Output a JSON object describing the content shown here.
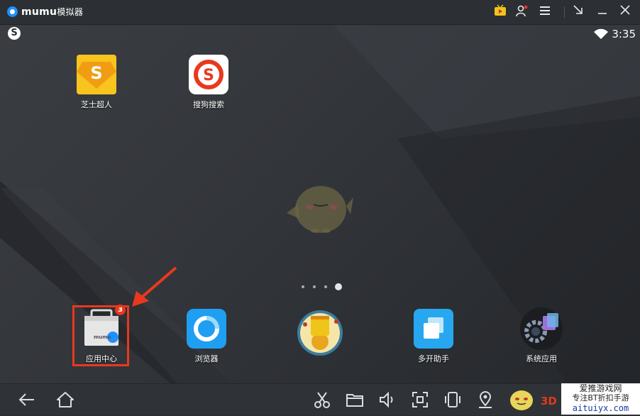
{
  "titlebar": {
    "app_name": "mumu",
    "app_name_suffix": "模拟器"
  },
  "statusbar": {
    "time": "3:35"
  },
  "desktop": {
    "apps": [
      {
        "label": "芝士超人"
      },
      {
        "label": "搜狗搜索"
      }
    ],
    "dock": [
      {
        "label": "应用中心",
        "badge": "3"
      },
      {
        "label": "浏览器"
      },
      {
        "label": ""
      },
      {
        "label": "多开助手"
      },
      {
        "label": "系统应用"
      }
    ]
  },
  "watermark": {
    "line1": "爱推游戏网",
    "line2": "专注BT折扣手游",
    "line3": "aituiyx.com",
    "logo_text": "3D"
  },
  "colors": {
    "accent_red": "#e8391e",
    "titlebar_bg": "#2c2f34",
    "browser_blue": "#1e9ff2"
  }
}
